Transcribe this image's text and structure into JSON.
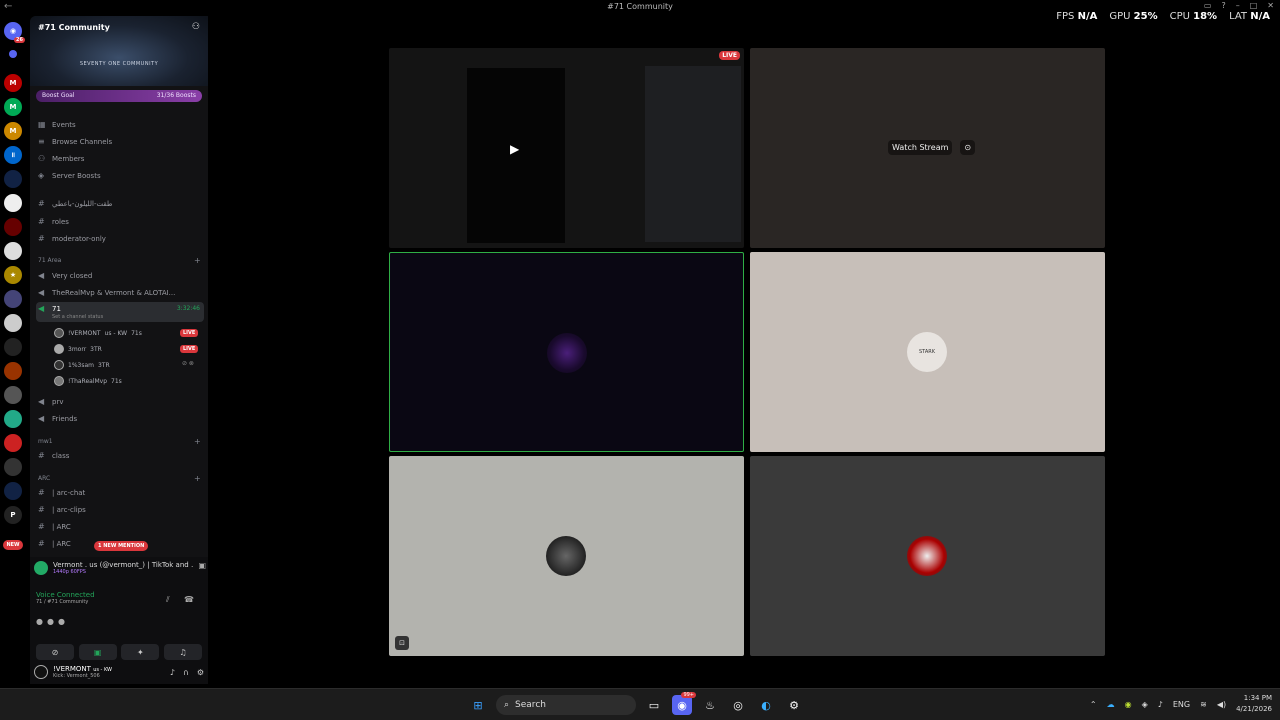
{
  "window": {
    "title": "#71 Community"
  },
  "overlay": {
    "fps_label": "FPS",
    "fps": "N/A",
    "gpu_label": "GPU",
    "gpu": "25%",
    "cpu_label": "CPU",
    "cpu": "18%",
    "lat_label": "LAT",
    "lat": "N/A"
  },
  "servers": {
    "dm_badge": "26"
  },
  "server": {
    "name": "#71 Community",
    "banner_text": "SEVENTY ONE COMMUNITY",
    "boost_goal_label": "Boost Goal",
    "boost_goal_value": "31/36 Boosts",
    "menu": [
      "Events",
      "Browse Channels",
      "Members",
      "Server Boosts"
    ],
    "text_channels": [
      "طقت-الليلون-باعطي",
      "roles",
      "moderator-only"
    ],
    "category_71area": "71 Area",
    "voice_very_closed": "Very closed",
    "voice_therealmvp": "TheRealMvp & Vermont & ALOTAI...",
    "active_voice": {
      "name": "71",
      "time": "3:32:46",
      "status": "Set a channel status"
    },
    "voice_users": [
      {
        "name": "!VERMONT",
        "tag": "us - KW",
        "extra": "71s",
        "live": "LIVE"
      },
      {
        "name": "3morr",
        "tag": "3TR",
        "extra": "",
        "live": "LIVE"
      },
      {
        "name": "1%3sam",
        "tag": "3TR",
        "extra": "",
        "live": ""
      },
      {
        "name": "!ThaRealMvp",
        "tag": "",
        "extra": "71s",
        "live": ""
      }
    ],
    "voice_prv": "prv",
    "voice_friends": "Friends",
    "category_mw1": "mw1",
    "text_class": "class",
    "category_arc": "ARC",
    "arc_channels": [
      "| arc-chat",
      "| arc-clips",
      "| ARC",
      "| ARC"
    ],
    "new_mention": "1 NEW MENTION",
    "new_badge": "NEW"
  },
  "panel": {
    "activity_title": "Vermont . us (@vermont_) | TikTok and 2...",
    "activity_sub": "1440p 60FPS",
    "voice_connected": "Voice Connected",
    "voice_location": "71 / #71 Community",
    "user_name": "!VERMONT",
    "user_tag": "us - KW",
    "user_status": "Kick: Vermont_506"
  },
  "stage": {
    "live_badge": "LIVE",
    "watch_stream": "Watch Stream",
    "avatar_t4_text": "STARK"
  },
  "taskbar": {
    "search_label": "Search",
    "discord_badge": "99+",
    "lang": "ENG",
    "time": "1:34 PM",
    "date": "4/21/2026"
  },
  "colors": {
    "live": "#da373c",
    "voice_connected": "#23a55a",
    "speaking_border": "#2fae45",
    "boost": "#8a3fa8"
  }
}
